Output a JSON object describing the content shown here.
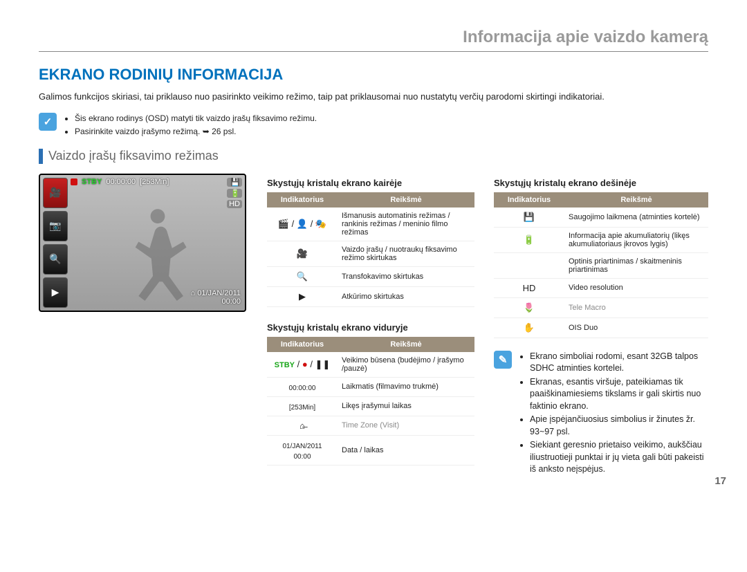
{
  "chapter": "Informacija apie vaizdo kamerą",
  "heading": "EKRANO RODINIŲ INFORMACIJA",
  "intro": "Galimos funkcijos skiriasi, tai priklauso nuo pasirinkto veikimo režimo, taip pat priklausomai nuo nustatytų verčių parodomi skirtingi indikatoriai.",
  "top_notes": [
    "Šis ekrano rodinys (OSD) matyti tik vaizdo įrašų fiksavimo režimu.",
    "Pasirinkite vaizdo įrašymo režimą. ➥ 26 psl."
  ],
  "subheading": "Vaizdo įrašų fiksavimo režimas",
  "camera": {
    "stby": "STBY",
    "timecode": "00:00:00",
    "remain": "[253Min]",
    "date": "01/JAN/2011",
    "time": "00:00",
    "home_glyph": "⌂"
  },
  "table_headers": {
    "ind": "Indikatorius",
    "val": "Reikšmė"
  },
  "left_title": "Skystųjų kristalų ekrano kairėje",
  "left_rows": [
    {
      "icon": "🎬 / 👤 / 🎭",
      "text": "Išmanusis automatinis režimas / rankinis režimas / meninio filmo režimas"
    },
    {
      "icon": "🎥",
      "text": "Vaizdo įrašų / nuotraukų fiksavimo režimo skirtukas"
    },
    {
      "icon": "🔍",
      "text": "Transfokavimo skirtukas"
    },
    {
      "icon": "▶",
      "text": "Atkūrimo skirtukas"
    }
  ],
  "mid_title": "Skystųjų kristalų ekrano viduryje",
  "mid_rows": [
    {
      "icon_html": "<span class='stby-ind'>STBY</span> / <span class='red-dot'>●</span> / ❚❚",
      "text": "Veikimo būsena (budėjimo / įrašymo /pauzė)"
    },
    {
      "icon_html": "<span class='mini-text'>00:00:00</span>",
      "text": "Laikmatis (filmavimo trukmė)"
    },
    {
      "icon_html": "<span class='mini-text'>[253Min]</span>",
      "text": "Likęs įrašymui laikas"
    },
    {
      "icon_html": "⌂̶",
      "text": "Time Zone (Visit)",
      "muted": true
    },
    {
      "icon_html": "<span class='mini-text'>01/JAN/2011<br>00:00</span>",
      "text": "Data / laikas"
    }
  ],
  "right_title": "Skystųjų kristalų ekrano dešinėje",
  "right_rows": [
    {
      "icon": "💾",
      "text": "Saugojimo laikmena (atminties kortelė)"
    },
    {
      "icon": "🔋",
      "text": "Informacija apie akumuliatorių (likęs akumuliatoriaus įkrovos lygis)"
    },
    {
      "icon": "",
      "text": "Optinis priartinimas / skaitmeninis priartinimas"
    },
    {
      "icon": "HD",
      "text": "Video resolution"
    },
    {
      "icon": "🌷",
      "text": "Tele Macro",
      "muted": true
    },
    {
      "icon": "✋",
      "text": "OIS Duo"
    }
  ],
  "right_notes": [
    "Ekrano simboliai rodomi, esant 32GB talpos SDHC atminties kortelei.",
    "Ekranas, esantis viršuje, pateikiamas tik paaiškinamiesiems tikslams ir gali skirtis nuo faktinio ekrano.",
    "Apie įspėjančiuosius simbolius ir žinutes žr. 93~97 psl.",
    "Siekiant geresnio prietaiso veikimo, aukščiau iliustruotieji punktai ir jų vieta gali būti pakeisti iš anksto neįspėjus."
  ],
  "page_number": "17"
}
